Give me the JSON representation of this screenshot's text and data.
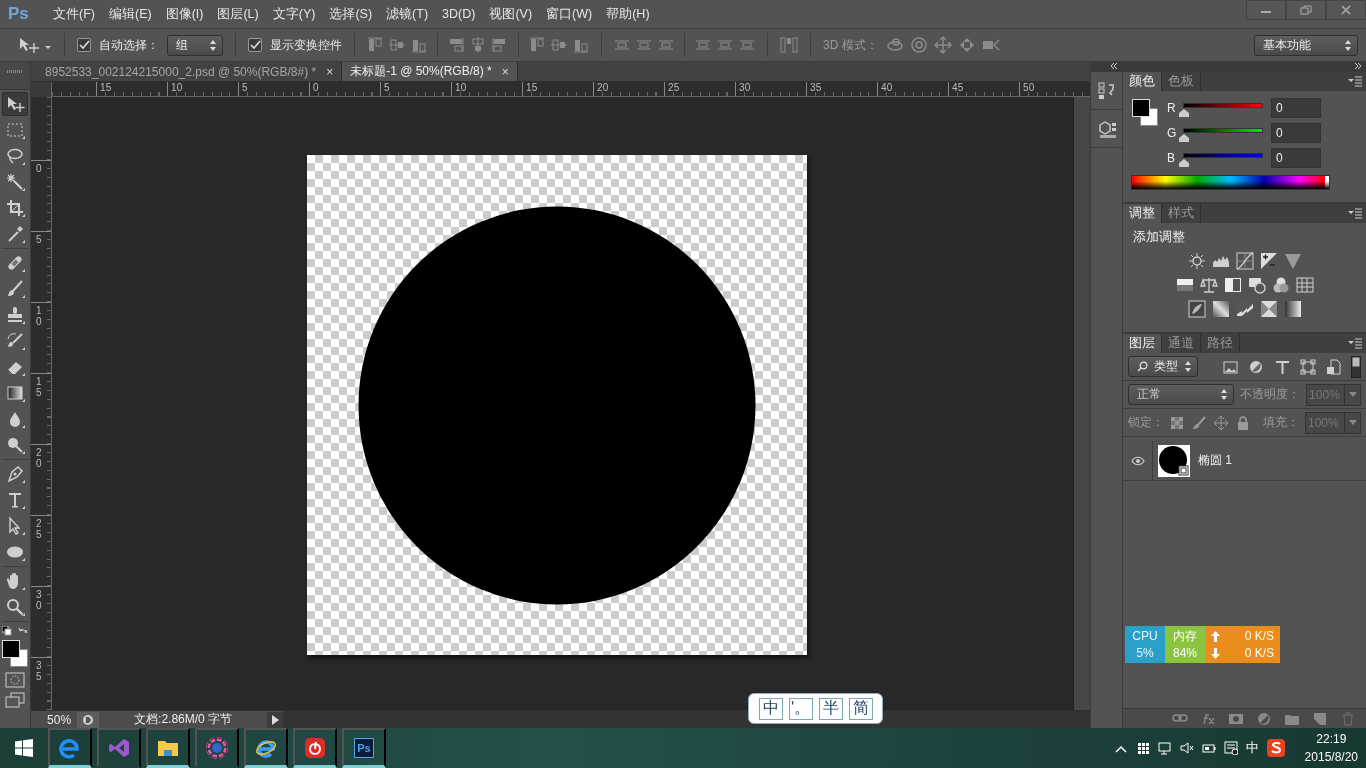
{
  "menu_bar": {
    "logo": "Ps",
    "items": [
      "文件(F)",
      "编辑(E)",
      "图像(I)",
      "图层(L)",
      "文字(Y)",
      "选择(S)",
      "滤镜(T)",
      "3D(D)",
      "视图(V)",
      "窗口(W)",
      "帮助(H)"
    ]
  },
  "options_bar": {
    "auto_select": {
      "label": "自动选择：",
      "checked": true
    },
    "auto_select_target": "组",
    "show_transform": {
      "label": "显示变换控件",
      "checked": true
    },
    "mode_label": "3D 模式：",
    "workspace": "基本功能"
  },
  "document_tabs": [
    {
      "title": "8952533_002124215000_2.psd @ 50%(RGB/8#) *",
      "close": "×",
      "selected": false
    },
    {
      "title": "未标题-1 @ 50%(RGB/8) *",
      "close": "×",
      "selected": true
    }
  ],
  "rulers": {
    "horizontal": [
      "15",
      "10",
      "5",
      "0",
      "5",
      "10",
      "15",
      "20",
      "25",
      "30",
      "35",
      "40",
      "45",
      "50"
    ],
    "vertical": [
      "0",
      "5",
      "10",
      "15",
      "20",
      "25",
      "30",
      "35"
    ]
  },
  "tool_groups": [
    [
      {
        "kind": "move",
        "selected": true
      },
      {
        "kind": "marquee",
        "selected": false
      },
      {
        "kind": "lasso",
        "selected": false
      },
      {
        "kind": "wand",
        "selected": false
      },
      {
        "kind": "crop",
        "selected": false
      },
      {
        "kind": "eyedropper",
        "selected": false
      }
    ],
    [
      {
        "kind": "bandage",
        "selected": false
      },
      {
        "kind": "brush",
        "selected": false
      },
      {
        "kind": "stamp",
        "selected": false
      },
      {
        "kind": "history",
        "selected": false
      },
      {
        "kind": "eraser",
        "selected": false
      },
      {
        "kind": "gradient",
        "selected": false
      },
      {
        "kind": "drop",
        "selected": false
      },
      {
        "kind": "dodge",
        "selected": false
      }
    ],
    [
      {
        "kind": "pen",
        "selected": false
      },
      {
        "kind": "type",
        "selected": false
      },
      {
        "kind": "pathselect",
        "selected": false
      },
      {
        "kind": "ellipse",
        "selected": false
      }
    ],
    [
      {
        "kind": "hand",
        "selected": false
      },
      {
        "kind": "zoom",
        "selected": false
      }
    ]
  ],
  "color_panel": {
    "tabs": [
      {
        "label": "颜色",
        "selected": true
      },
      {
        "label": "色板",
        "selected": false
      }
    ],
    "channels": [
      {
        "name": "R",
        "level": 0,
        "value": "0"
      },
      {
        "name": "G",
        "level": 0,
        "value": "0"
      },
      {
        "name": "B",
        "level": 0,
        "value": "0"
      }
    ]
  },
  "adjustments_panel": {
    "tabs": [
      {
        "label": "调整",
        "selected": true
      },
      {
        "label": "样式",
        "selected": false
      }
    ],
    "heading": "添加调整"
  },
  "layers_panel": {
    "tabs": [
      {
        "label": "图层",
        "selected": true
      },
      {
        "label": "通道",
        "selected": false
      },
      {
        "label": "路径",
        "selected": false
      }
    ],
    "filter": "类型",
    "blend_mode": "正常",
    "opacity_label": "不透明度：",
    "opacity": {
      "value": "100%",
      "disabled": true
    },
    "lock_label": "锁定：",
    "fill_label": "填充：",
    "fill": {
      "value": "100%",
      "disabled": true
    },
    "layers": [
      {
        "name": "椭圆 1",
        "visible": true
      }
    ]
  },
  "status_bar": {
    "zoom": "50%",
    "doc_info": "文档:2.86M/0 字节"
  },
  "system_monitor": {
    "cpu_label": "CPU",
    "cpu": "5%",
    "memory_label": "内存",
    "memory": "84%",
    "upload": "0 K/S",
    "download": "0 K/S"
  },
  "ime_bar": {
    "items": [
      "中",
      "'。",
      "半",
      "简"
    ]
  },
  "taskbar": {
    "apps": [
      {
        "kind": "edge",
        "running": true
      },
      {
        "kind": "studio",
        "running": false
      },
      {
        "kind": "folder",
        "running": true
      },
      {
        "kind": "wheel",
        "running": false
      },
      {
        "kind": "ie",
        "running": true
      },
      {
        "kind": "music",
        "running": true
      },
      {
        "kind": "ps",
        "label": "Ps",
        "running": true
      }
    ],
    "language": "中",
    "time": "22:19",
    "date": "2015/8/20"
  }
}
